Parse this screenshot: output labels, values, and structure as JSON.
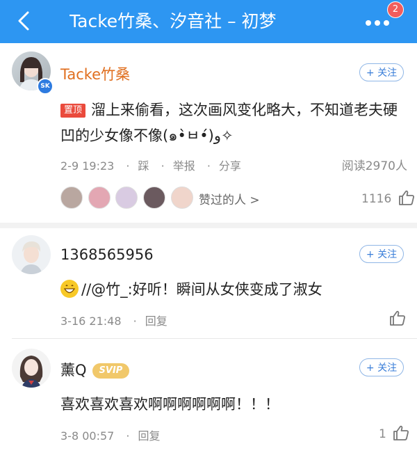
{
  "header": {
    "title": "Tacke竹桑、汐音社 – 初梦",
    "badge_count": "2"
  },
  "comments": [
    {
      "user": "Tacke竹桑",
      "follow_label": "+ 关注",
      "pin_label": "置顶",
      "text": "溜上来偷看，这次画风变化略大，不知道老夫硬凹的少女像不像(๑•̀ㅂ•́)و✧",
      "time": "2-9 19:23",
      "actions": [
        "踩",
        "举报",
        "分享"
      ],
      "reads": "阅读2970人",
      "likers_label": "赞过的人 >",
      "likes": "1116"
    },
    {
      "user": "1368565956",
      "follow_label": "+ 关注",
      "text": "//@竹_:好听！瞬间从女侠变成了淑女",
      "time": "3-16 21:48",
      "reply_label": "回复"
    },
    {
      "user": "薰Q",
      "vip": "SVIP",
      "follow_label": "+ 关注",
      "text": "喜欢喜欢喜欢啊啊啊啊啊啊！！！",
      "time": "3-8 00:57",
      "reply_label": "回复",
      "likes": "1"
    }
  ],
  "colors": {
    "header_bg": "#2d96f2",
    "author_name": "#e06f1f",
    "pin": "#ea4a3c",
    "svip": "#f1c86a"
  }
}
